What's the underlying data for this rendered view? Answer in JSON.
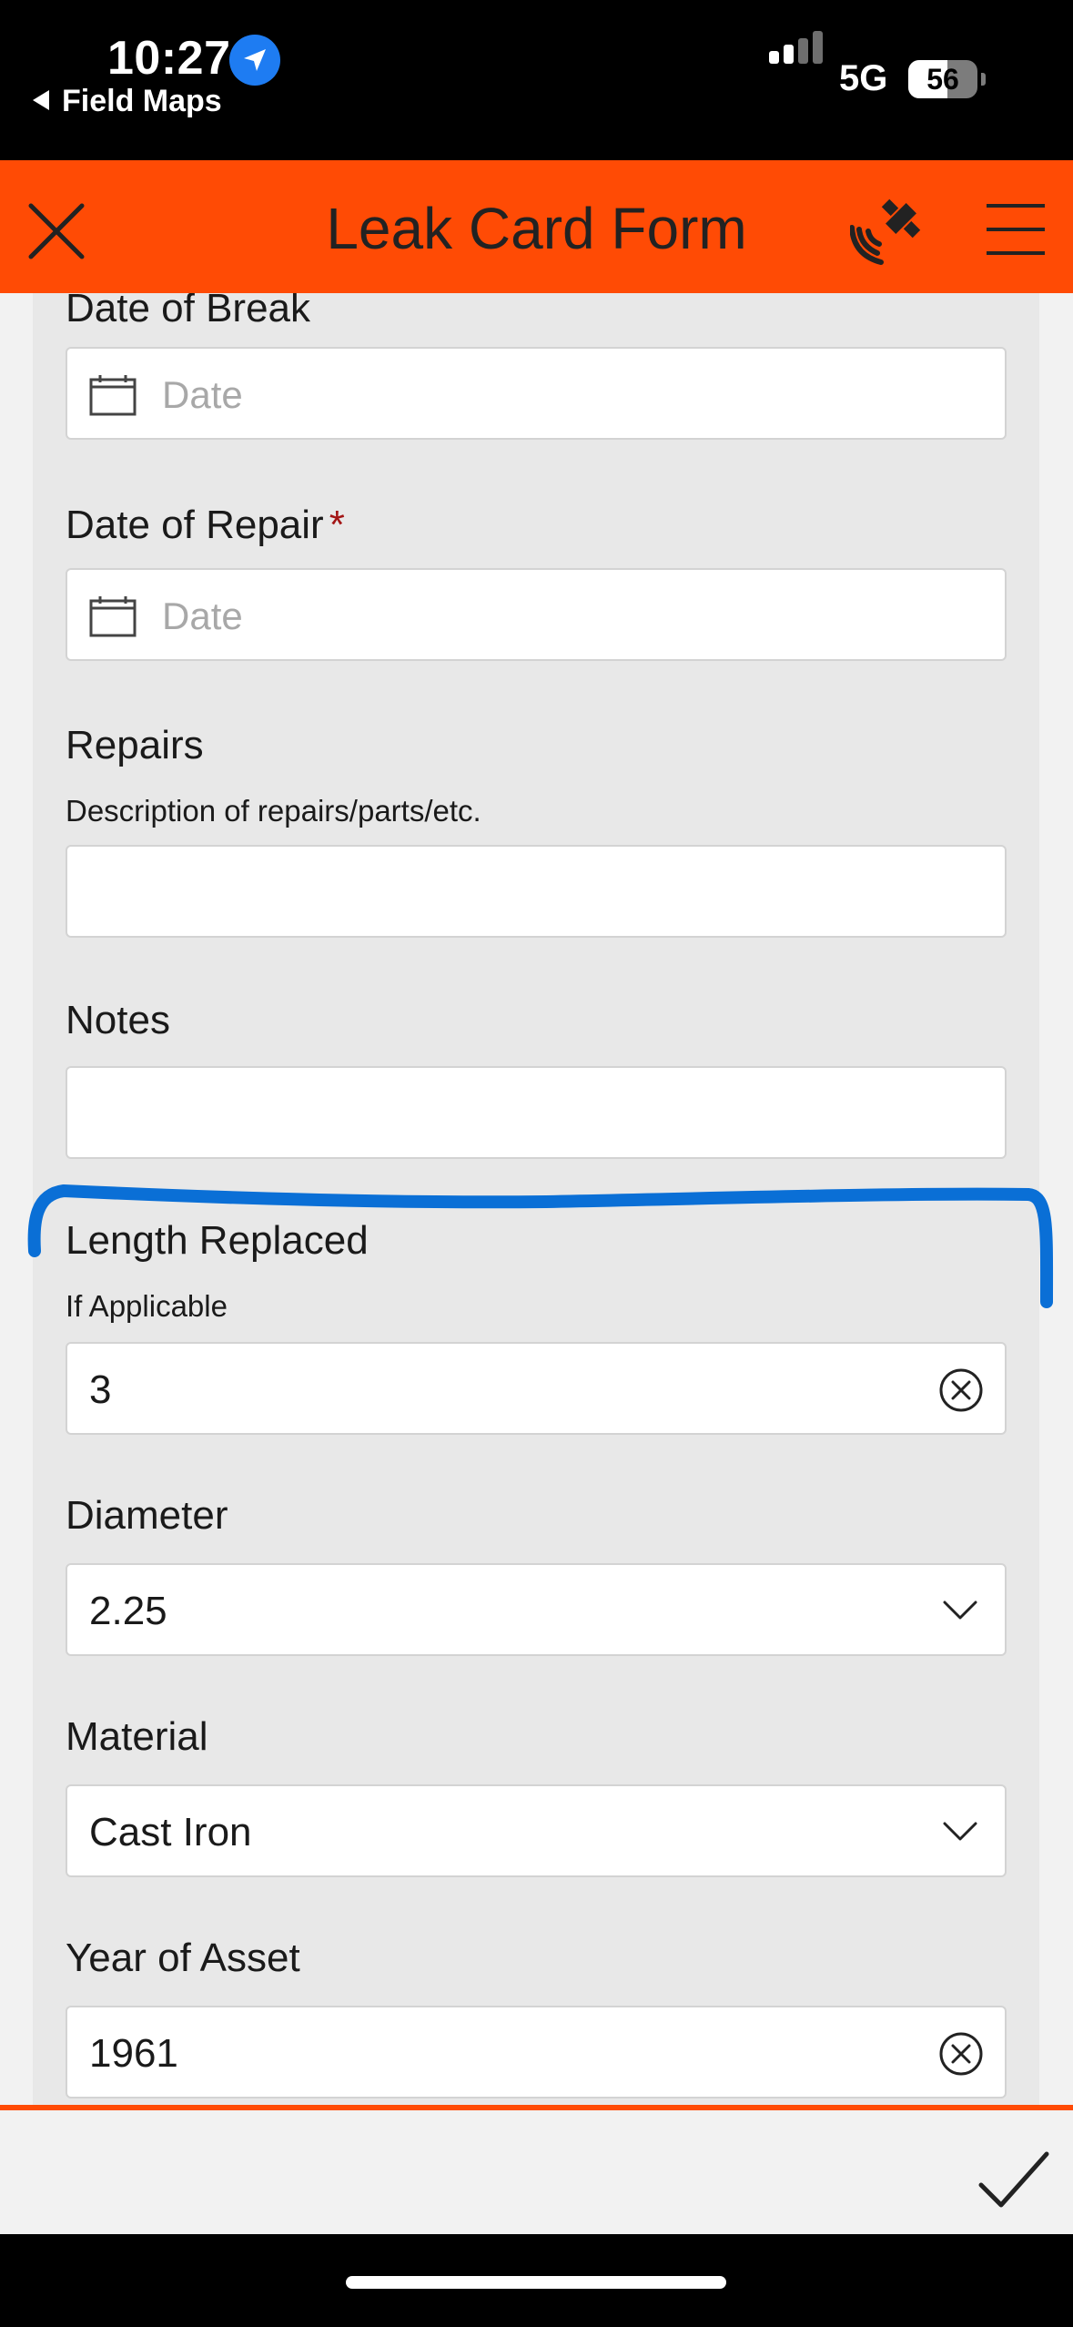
{
  "status_bar": {
    "time": "10:27",
    "back_app": "Field Maps",
    "network": "5G",
    "battery": "56",
    "battery_level": 0.56,
    "signal_bars_active": 2,
    "signal_bars_total": 4
  },
  "header": {
    "title": "Leak Card Form",
    "accent_color": "#ff4b05",
    "icons": [
      "close-icon",
      "gps-satellite-icon",
      "hamburger-menu-icon"
    ]
  },
  "fields": {
    "date_of_break": {
      "label": "Date of Break",
      "placeholder": "Date"
    },
    "date_of_repair": {
      "label": "Date of Repair",
      "required_mark": "*",
      "placeholder": "Date"
    },
    "repairs": {
      "label": "Repairs",
      "hint": "Description of repairs/parts/etc.",
      "value": ""
    },
    "notes": {
      "label": "Notes",
      "value": ""
    },
    "length_replaced": {
      "label": "Length Replaced",
      "hint": "If Applicable",
      "value": "3"
    },
    "diameter": {
      "label": "Diameter",
      "value": "2.25"
    },
    "material": {
      "label": "Material",
      "value": "Cast Iron"
    },
    "year_of_asset": {
      "label": "Year of Asset",
      "value": "1961"
    }
  },
  "annotation_color": "#0a6fd6",
  "footer": {
    "icons": [
      "checkmark-icon"
    ]
  }
}
